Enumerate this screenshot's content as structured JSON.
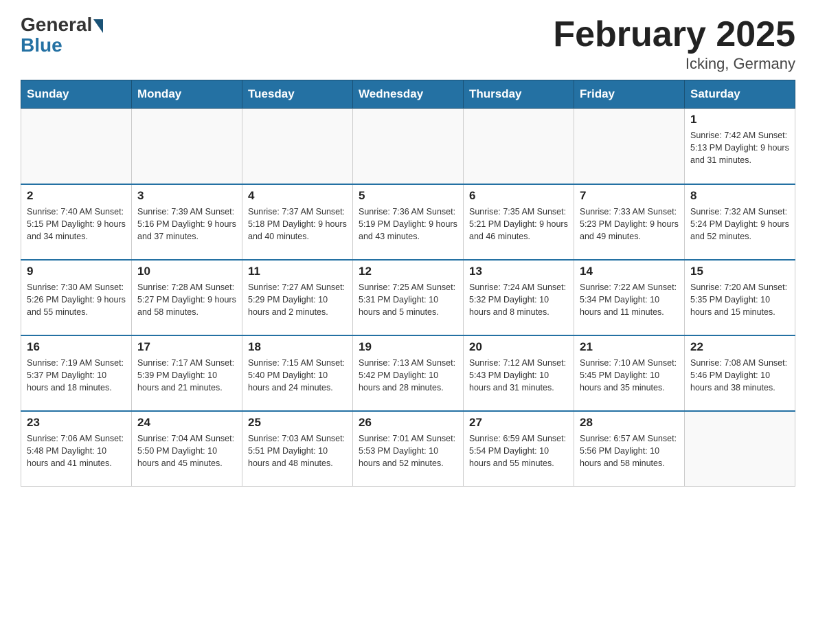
{
  "header": {
    "logo_general": "General",
    "logo_blue": "Blue",
    "title": "February 2025",
    "location": "Icking, Germany"
  },
  "weekdays": [
    "Sunday",
    "Monday",
    "Tuesday",
    "Wednesday",
    "Thursday",
    "Friday",
    "Saturday"
  ],
  "weeks": [
    [
      {
        "day": "",
        "info": ""
      },
      {
        "day": "",
        "info": ""
      },
      {
        "day": "",
        "info": ""
      },
      {
        "day": "",
        "info": ""
      },
      {
        "day": "",
        "info": ""
      },
      {
        "day": "",
        "info": ""
      },
      {
        "day": "1",
        "info": "Sunrise: 7:42 AM\nSunset: 5:13 PM\nDaylight: 9 hours and 31 minutes."
      }
    ],
    [
      {
        "day": "2",
        "info": "Sunrise: 7:40 AM\nSunset: 5:15 PM\nDaylight: 9 hours and 34 minutes."
      },
      {
        "day": "3",
        "info": "Sunrise: 7:39 AM\nSunset: 5:16 PM\nDaylight: 9 hours and 37 minutes."
      },
      {
        "day": "4",
        "info": "Sunrise: 7:37 AM\nSunset: 5:18 PM\nDaylight: 9 hours and 40 minutes."
      },
      {
        "day": "5",
        "info": "Sunrise: 7:36 AM\nSunset: 5:19 PM\nDaylight: 9 hours and 43 minutes."
      },
      {
        "day": "6",
        "info": "Sunrise: 7:35 AM\nSunset: 5:21 PM\nDaylight: 9 hours and 46 minutes."
      },
      {
        "day": "7",
        "info": "Sunrise: 7:33 AM\nSunset: 5:23 PM\nDaylight: 9 hours and 49 minutes."
      },
      {
        "day": "8",
        "info": "Sunrise: 7:32 AM\nSunset: 5:24 PM\nDaylight: 9 hours and 52 minutes."
      }
    ],
    [
      {
        "day": "9",
        "info": "Sunrise: 7:30 AM\nSunset: 5:26 PM\nDaylight: 9 hours and 55 minutes."
      },
      {
        "day": "10",
        "info": "Sunrise: 7:28 AM\nSunset: 5:27 PM\nDaylight: 9 hours and 58 minutes."
      },
      {
        "day": "11",
        "info": "Sunrise: 7:27 AM\nSunset: 5:29 PM\nDaylight: 10 hours and 2 minutes."
      },
      {
        "day": "12",
        "info": "Sunrise: 7:25 AM\nSunset: 5:31 PM\nDaylight: 10 hours and 5 minutes."
      },
      {
        "day": "13",
        "info": "Sunrise: 7:24 AM\nSunset: 5:32 PM\nDaylight: 10 hours and 8 minutes."
      },
      {
        "day": "14",
        "info": "Sunrise: 7:22 AM\nSunset: 5:34 PM\nDaylight: 10 hours and 11 minutes."
      },
      {
        "day": "15",
        "info": "Sunrise: 7:20 AM\nSunset: 5:35 PM\nDaylight: 10 hours and 15 minutes."
      }
    ],
    [
      {
        "day": "16",
        "info": "Sunrise: 7:19 AM\nSunset: 5:37 PM\nDaylight: 10 hours and 18 minutes."
      },
      {
        "day": "17",
        "info": "Sunrise: 7:17 AM\nSunset: 5:39 PM\nDaylight: 10 hours and 21 minutes."
      },
      {
        "day": "18",
        "info": "Sunrise: 7:15 AM\nSunset: 5:40 PM\nDaylight: 10 hours and 24 minutes."
      },
      {
        "day": "19",
        "info": "Sunrise: 7:13 AM\nSunset: 5:42 PM\nDaylight: 10 hours and 28 minutes."
      },
      {
        "day": "20",
        "info": "Sunrise: 7:12 AM\nSunset: 5:43 PM\nDaylight: 10 hours and 31 minutes."
      },
      {
        "day": "21",
        "info": "Sunrise: 7:10 AM\nSunset: 5:45 PM\nDaylight: 10 hours and 35 minutes."
      },
      {
        "day": "22",
        "info": "Sunrise: 7:08 AM\nSunset: 5:46 PM\nDaylight: 10 hours and 38 minutes."
      }
    ],
    [
      {
        "day": "23",
        "info": "Sunrise: 7:06 AM\nSunset: 5:48 PM\nDaylight: 10 hours and 41 minutes."
      },
      {
        "day": "24",
        "info": "Sunrise: 7:04 AM\nSunset: 5:50 PM\nDaylight: 10 hours and 45 minutes."
      },
      {
        "day": "25",
        "info": "Sunrise: 7:03 AM\nSunset: 5:51 PM\nDaylight: 10 hours and 48 minutes."
      },
      {
        "day": "26",
        "info": "Sunrise: 7:01 AM\nSunset: 5:53 PM\nDaylight: 10 hours and 52 minutes."
      },
      {
        "day": "27",
        "info": "Sunrise: 6:59 AM\nSunset: 5:54 PM\nDaylight: 10 hours and 55 minutes."
      },
      {
        "day": "28",
        "info": "Sunrise: 6:57 AM\nSunset: 5:56 PM\nDaylight: 10 hours and 58 minutes."
      },
      {
        "day": "",
        "info": ""
      }
    ]
  ]
}
